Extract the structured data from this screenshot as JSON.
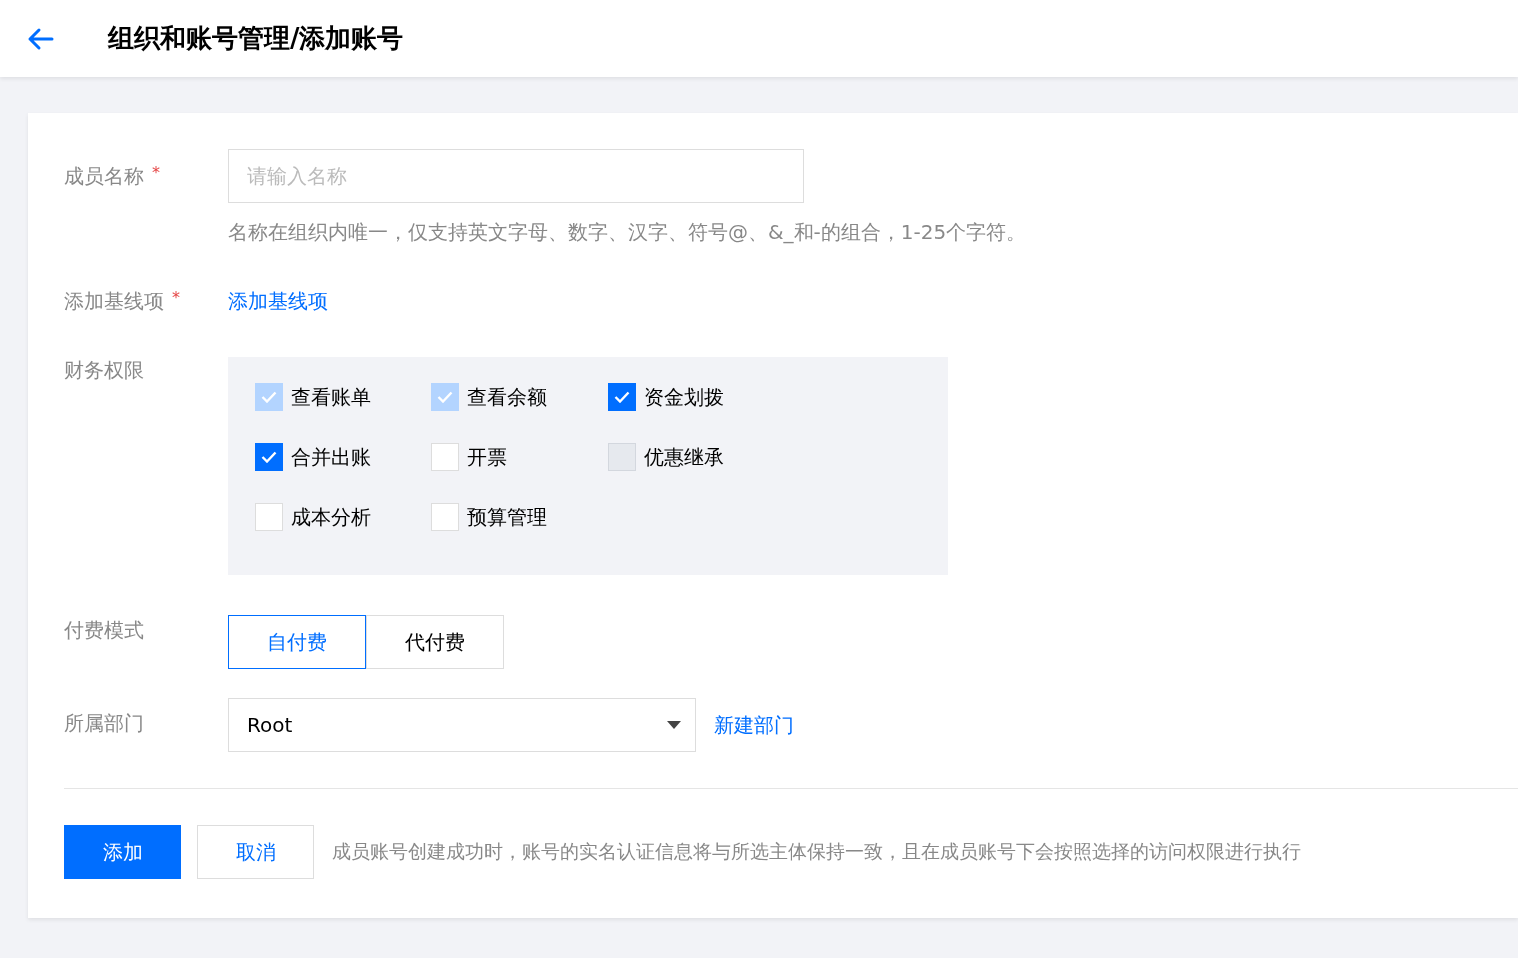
{
  "header": {
    "title": "组织和账号管理/添加账号"
  },
  "form": {
    "name_field": {
      "label": "成员名称",
      "required_mark": "*",
      "placeholder": "请输入名称",
      "hint": "名称在组织内唯一，仅支持英文字母、数字、汉字、符号@、&_和-的组合，1-25个字符。"
    },
    "baseline": {
      "label": "添加基线项",
      "required_mark": "*",
      "link": "添加基线项"
    },
    "permissions": {
      "label": "财务权限",
      "items": [
        {
          "label": "查看账单",
          "checked": true,
          "disabled": true
        },
        {
          "label": "查看余额",
          "checked": true,
          "disabled": true
        },
        {
          "label": "资金划拨",
          "checked": true,
          "disabled": false
        },
        {
          "label": "合并出账",
          "checked": true,
          "disabled": false
        },
        {
          "label": "开票",
          "checked": false,
          "disabled": false
        },
        {
          "label": "优惠继承",
          "checked": false,
          "disabled": true
        },
        {
          "label": "成本分析",
          "checked": false,
          "disabled": false
        },
        {
          "label": "预算管理",
          "checked": false,
          "disabled": false
        }
      ]
    },
    "payment": {
      "label": "付费模式",
      "options": [
        {
          "label": "自付费",
          "selected": true
        },
        {
          "label": "代付费",
          "selected": false
        }
      ]
    },
    "department": {
      "label": "所属部门",
      "value": "Root",
      "link": "新建部门"
    }
  },
  "footer": {
    "buttons": [
      {
        "label": "添加",
        "kind": "primary"
      },
      {
        "label": "取消",
        "kind": "secondary"
      }
    ],
    "note": "成员账号创建成功时，账号的实名认证信息将与所选主体保持一致，且在成员账号下会按照选择的访问权限进行执行"
  }
}
